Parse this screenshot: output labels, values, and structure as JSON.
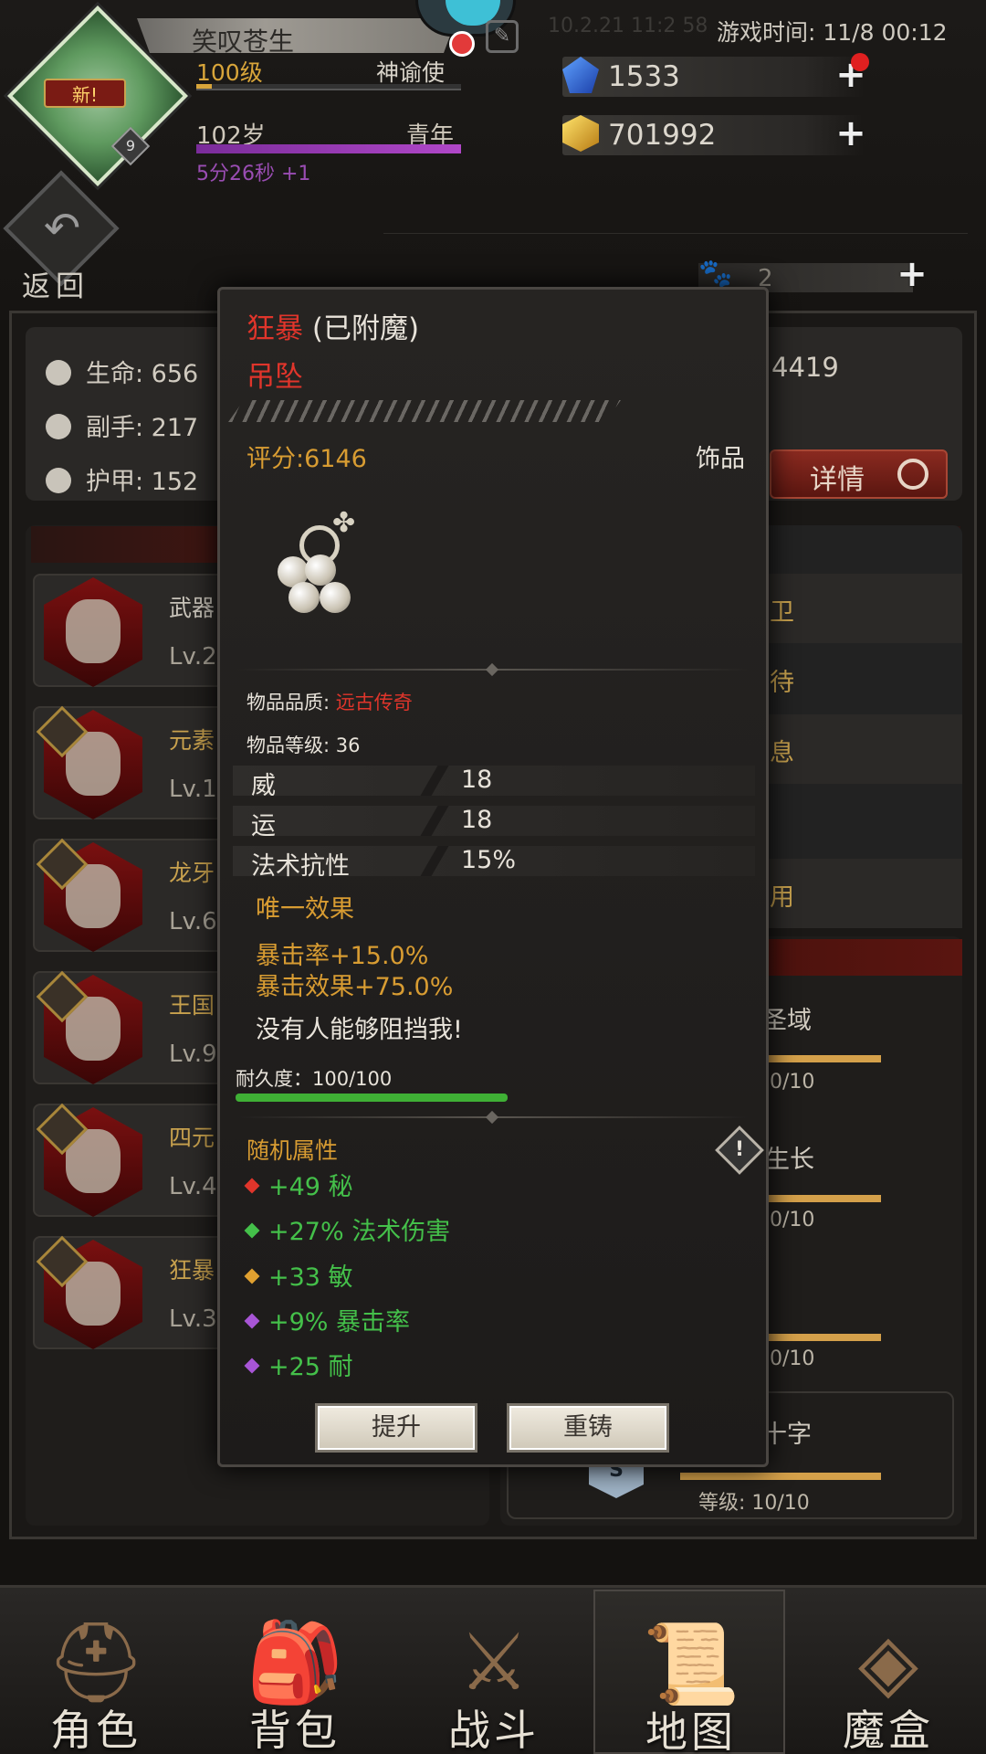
{
  "header": {
    "player_name": "笑叹苍生",
    "level": "100级",
    "title": "神谕使",
    "level_progress": 0.06,
    "age": "102岁",
    "age_stage": "青年",
    "age_progress": 1.0,
    "age_timer": "5分26秒 +1",
    "avatar_badge": "新!",
    "avatar_level": "9",
    "faded_text": "10.2.21 11:2 58",
    "game_time": "游戏时间: 11/8 00:12",
    "diamonds": "1533",
    "gold": "701992",
    "stamina": "2",
    "back_label": "返回"
  },
  "stats": {
    "hp": "生命: 656",
    "offhand": "副手: 217",
    "armor": "护甲: 152",
    "right_value": "4419",
    "detail_button": "详情"
  },
  "equipment": [
    {
      "name": "武器",
      "lv": "Lv.2"
    },
    {
      "name": "元素",
      "lv": "Lv.1"
    },
    {
      "name": "龙牙",
      "lv": "Lv.6"
    },
    {
      "name": "王国",
      "lv": "Lv.9"
    },
    {
      "name": "四元",
      "lv": "Lv.4"
    },
    {
      "name": "狂暴",
      "lv": "Lv.3"
    }
  ],
  "right_list": [
    "卫",
    "待",
    "息",
    "用"
  ],
  "skills": [
    {
      "name": "圣域",
      "lv": "0/10"
    },
    {
      "name": "生长",
      "lv": "0/10"
    },
    {
      "name": "",
      "lv": "0/10"
    },
    {
      "name": "十字",
      "lv": "等级: 10/10"
    }
  ],
  "skill_badge": "S",
  "item": {
    "name_prefix": "狂暴",
    "enchant_status": "(已附魔)",
    "type_name": "吊坠",
    "score": "评分:6146",
    "category": "饰品",
    "quality_label": "物品品质:",
    "quality_value": "远古传奇",
    "item_level": "物品等级: 36",
    "attributes": [
      {
        "key": "威",
        "value": "18"
      },
      {
        "key": "运",
        "value": "18"
      },
      {
        "key": "法术抗性",
        "value": "15%"
      }
    ],
    "unique_title": "唯一效果",
    "unique_effects": [
      "暴击率+15.0%",
      "暴击效果+75.0%"
    ],
    "flavor": "没有人能够阻挡我!",
    "durability": "耐久度：100/100",
    "durability_ratio": 1.0,
    "random_title": "随机属性",
    "random_stats": [
      {
        "text": "+49 秘",
        "gem": "#e0352b"
      },
      {
        "text": "+27% 法术伤害",
        "gem": "#44c04a"
      },
      {
        "text": "+33 敏",
        "gem": "#e0a030"
      },
      {
        "text": "+9% 暴击率",
        "gem": "#a855d6"
      },
      {
        "text": "+25 耐",
        "gem": "#a855d6"
      }
    ],
    "upgrade_button": "提升",
    "reforge_button": "重铸"
  },
  "nav": [
    {
      "label": "角色",
      "icon": "helmet-icon"
    },
    {
      "label": "背包",
      "icon": "backpack-icon"
    },
    {
      "label": "战斗",
      "icon": "sword-shield-icon"
    },
    {
      "label": "地图",
      "icon": "scroll-map-icon"
    },
    {
      "label": "魔盒",
      "icon": "magic-box-icon"
    }
  ],
  "colors": {
    "accent_gold": "#d89c32",
    "legendary_red": "#e0352b",
    "random_stat_green": "#44c04a",
    "durability_green": "#3fb035"
  }
}
